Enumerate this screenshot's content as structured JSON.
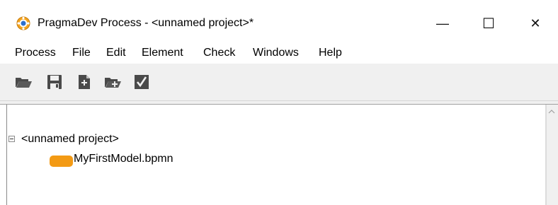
{
  "window": {
    "title": "PragmaDev Process - <unnamed project>*",
    "controls": {
      "minimize": "—",
      "maximize": "☐",
      "close": "✕"
    },
    "app_icon": "pragmadev-icon",
    "icon_colors": {
      "outer": "#f3a31f",
      "inner": "#2d6fcf"
    }
  },
  "menubar": {
    "items": [
      {
        "label": "Process"
      },
      {
        "label": "File"
      },
      {
        "label": "Edit"
      },
      {
        "label": "Element"
      },
      {
        "label": "Check"
      },
      {
        "label": "Windows"
      },
      {
        "label": "Help"
      }
    ]
  },
  "toolbar": {
    "buttons": [
      {
        "icon": "open-folder-icon"
      },
      {
        "icon": "save-icon"
      },
      {
        "icon": "new-document-icon"
      },
      {
        "icon": "add-folder-icon"
      },
      {
        "icon": "check-icon"
      }
    ],
    "icon_color": "#4a4a4a"
  },
  "tree": {
    "root": {
      "label": "<unnamed project>",
      "expanded": true,
      "children": [
        {
          "label": "MyFirstModel.bpmn",
          "icon": "bpmn-task-icon",
          "icon_color": "#f39a14"
        }
      ]
    }
  }
}
